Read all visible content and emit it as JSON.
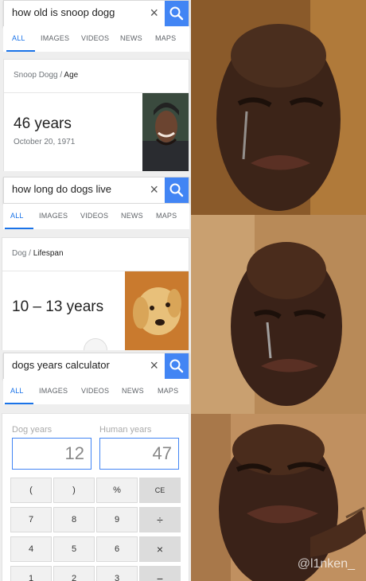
{
  "panels": [
    {
      "search": {
        "query": "how old is snoop dogg"
      },
      "tabs": [
        "ALL",
        "IMAGES",
        "VIDEOS",
        "NEWS",
        "MAPS"
      ],
      "card": {
        "crumb_subject": "Snoop Dogg",
        "crumb_attr": "Age",
        "value": "46 years",
        "subvalue": "October 20, 1971"
      }
    },
    {
      "search": {
        "query": "how long do dogs live"
      },
      "tabs": [
        "ALL",
        "IMAGES",
        "VIDEOS",
        "NEWS",
        "MAPS"
      ],
      "card": {
        "crumb_subject": "Dog",
        "crumb_attr": "Lifespan",
        "value": "10 – 13 years"
      }
    },
    {
      "search": {
        "query": "dogs years calculator"
      },
      "tabs": [
        "ALL",
        "IMAGES",
        "VIDEOS",
        "NEWS",
        "MAPS"
      ],
      "calculator": {
        "dog_label": "Dog years",
        "human_label": "Human years",
        "dog_value": "12",
        "human_value": "47",
        "keys": [
          "(",
          ")",
          "%",
          "CE",
          "7",
          "8",
          "9",
          "÷",
          "4",
          "5",
          "6",
          "×",
          "1",
          "2",
          "3",
          "−"
        ]
      }
    }
  ],
  "watermark": "@l1nken_",
  "colors": {
    "accent": "#4285f4",
    "active_tab": "#1a73e8"
  }
}
